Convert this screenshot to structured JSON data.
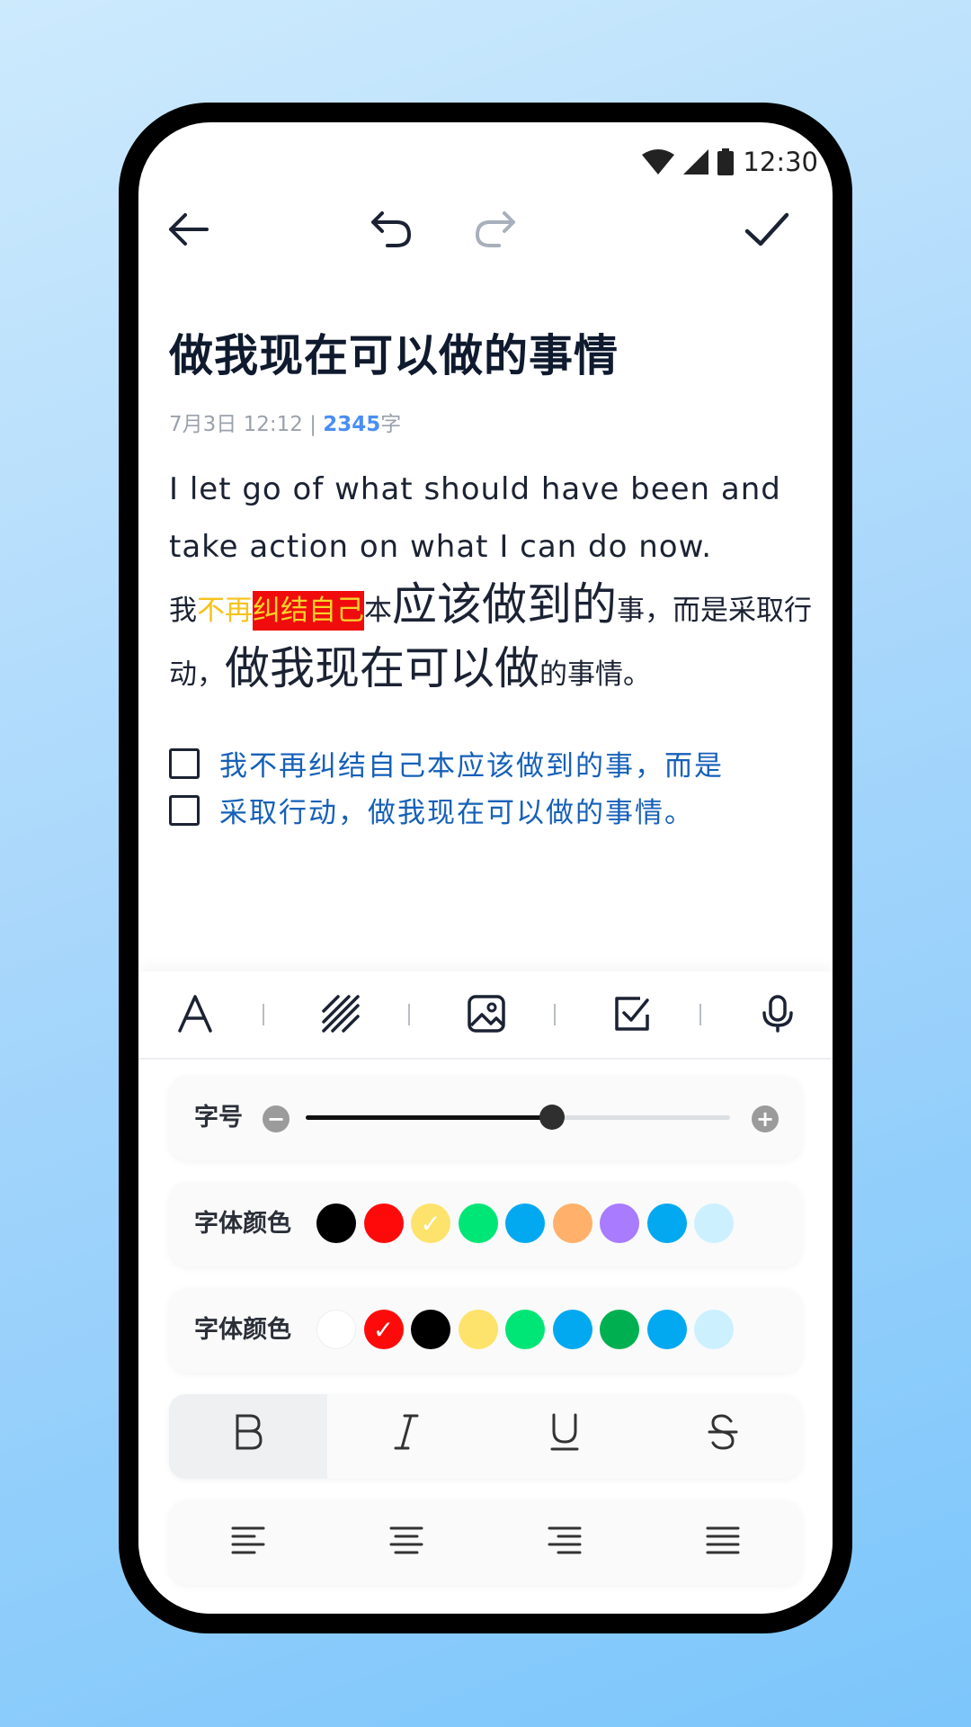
{
  "status": {
    "time": "12:30"
  },
  "note": {
    "title": "做我现在可以做的事情",
    "meta_date": "7月3日 12:12",
    "meta_sep": "|",
    "word_count": "2345",
    "word_unit": "字",
    "english_text": "I let go of what should have been and take action on what I can do now.",
    "cn_segments": [
      "我",
      "不再",
      "纠结自己",
      "本",
      "应该做到的",
      "事，而是采取行动，",
      "做我现在可以做",
      "的事情。"
    ],
    "todos": [
      {
        "text": "我不再纠结自己本应该做到的事，而是",
        "checked": false
      },
      {
        "text": "采取行动，做我现在可以做的事情。",
        "checked": false
      }
    ]
  },
  "panel": {
    "font_size_label": "字号",
    "font_size_level": 0.58,
    "font_color_label": "字体颜色",
    "font_colors": [
      "#000000",
      "#ff0a0a",
      "#fde36b",
      "#00e676",
      "#02a9f0",
      "#ffb06b",
      "#a97bff",
      "#02a9f0",
      "#cdf0ff"
    ],
    "font_color_selected_index": 2,
    "bg_color_label": "字体颜色",
    "bg_colors": [
      "#ffffff",
      "#ff0a0a",
      "#000000",
      "#fde36b",
      "#00e676",
      "#02a9f0",
      "#00b050",
      "#02a9f0",
      "#cdf0ff"
    ],
    "bg_color_selected_index": 1,
    "format_buttons": [
      "B",
      "I",
      "U",
      "S"
    ],
    "active_format": "B"
  }
}
